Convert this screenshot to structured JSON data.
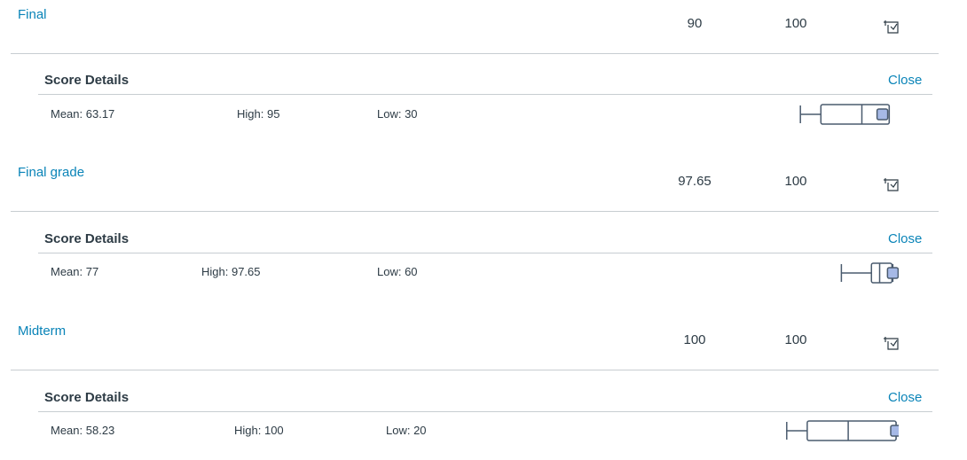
{
  "assignments": [
    {
      "name": "Final",
      "score": "90",
      "out_of": "100",
      "details": {
        "title": "Score Details",
        "close_label": "Close",
        "mean_text": "Mean: 63.17",
        "high_text": "High: 95",
        "low_text": "Low: 30",
        "stats": {
          "min": 30,
          "q1": 45,
          "median": 75,
          "q3": 95,
          "max": 95,
          "student": 90
        }
      }
    },
    {
      "name": "Final grade",
      "score": "97.65",
      "out_of": "100",
      "details": {
        "title": "Score Details",
        "close_label": "Close",
        "mean_text": "Mean: 77",
        "high_text": "High: 97.65",
        "low_text": "Low: 60",
        "stats": {
          "min": 60,
          "q1": 82,
          "median": 88,
          "q3": 97,
          "max": 97.65,
          "student": 97.65
        }
      }
    },
    {
      "name": "Midterm",
      "score": "100",
      "out_of": "100",
      "details": {
        "title": "Score Details",
        "close_label": "Close",
        "mean_text": "Mean: 58.23",
        "high_text": "High: 100",
        "low_text": "Low: 20",
        "stats": {
          "min": 20,
          "q1": 35,
          "median": 65,
          "q3": 100,
          "max": 100,
          "student": 100
        }
      }
    }
  ],
  "icons": {
    "rubric": "rubric-icon"
  },
  "colors": {
    "link": "#0a84b8",
    "text": "#2d3b45",
    "divider": "#c7cdd1",
    "marker_fill": "#a6b9e6",
    "marker_stroke": "#4a5b6e"
  }
}
